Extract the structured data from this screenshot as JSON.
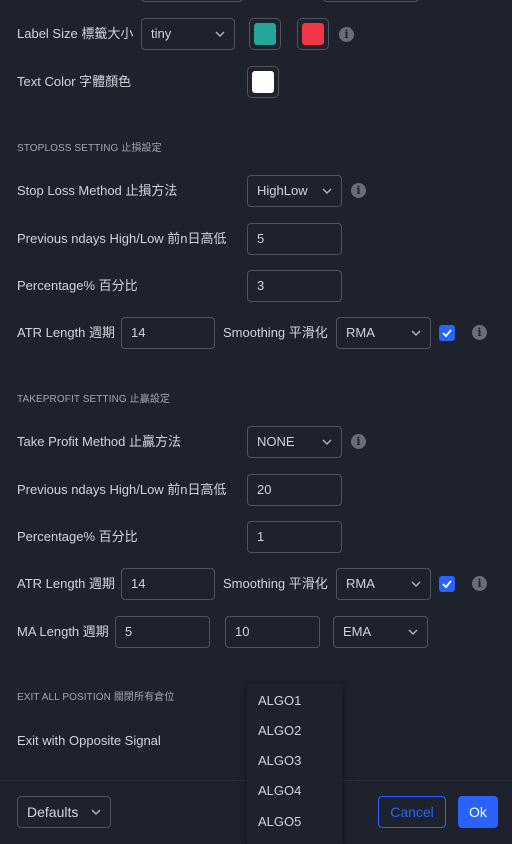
{
  "label_size": {
    "label": "Label Size 標籤大小",
    "value": "tiny",
    "color1": "#26a69a",
    "color2": "#f23645"
  },
  "text_color": {
    "label": "Text Color 字體顏色",
    "color": "#ffffff"
  },
  "stoploss": {
    "header": "STOPLOSS SETTING 止損設定",
    "method_label": "Stop Loss Method 止損方法",
    "method_value": "HighLow",
    "prev_label": "Previous ndays High/Low 前n日高低",
    "prev_value": "5",
    "pct_label": "Percentage% 百分比",
    "pct_value": "3",
    "atr_label": "ATR Length 週期",
    "atr_value": "14",
    "smooth_label": "Smoothing 平滑化",
    "smooth_value": "RMA"
  },
  "takeprofit": {
    "header": "TAKEPROFIT SETTING 止贏設定",
    "method_label": "Take Profit Method 止贏方法",
    "method_value": "NONE",
    "prev_label": "Previous ndays High/Low 前n日高低",
    "prev_value": "20",
    "pct_label": "Percentage% 百分比",
    "pct_value": "1",
    "atr_label": "ATR Length 週期",
    "atr_value": "14",
    "smooth_label": "Smoothing 平滑化",
    "smooth_value": "RMA",
    "ma_label": "MA Length 週期",
    "ma_value1": "5",
    "ma_value2": "10",
    "ma_type": "EMA"
  },
  "exit": {
    "header": "EXIT ALL POSITION 關閉所有倉位",
    "opposite_label": "Exit with Opposite Signal"
  },
  "dropdown_options": [
    "ALGO1",
    "ALGO2",
    "ALGO3",
    "ALGO4",
    "ALGO5"
  ],
  "footer": {
    "defaults_label": "Defaults",
    "cancel_label": "Cancel",
    "ok_label": "Ok"
  },
  "icons": {
    "info": "info-icon",
    "chevron": "chevron-down-icon",
    "check": "checkmark-icon"
  },
  "colors": {
    "accent": "#2962ff",
    "bg": "#1e222d",
    "border": "#50535e"
  }
}
